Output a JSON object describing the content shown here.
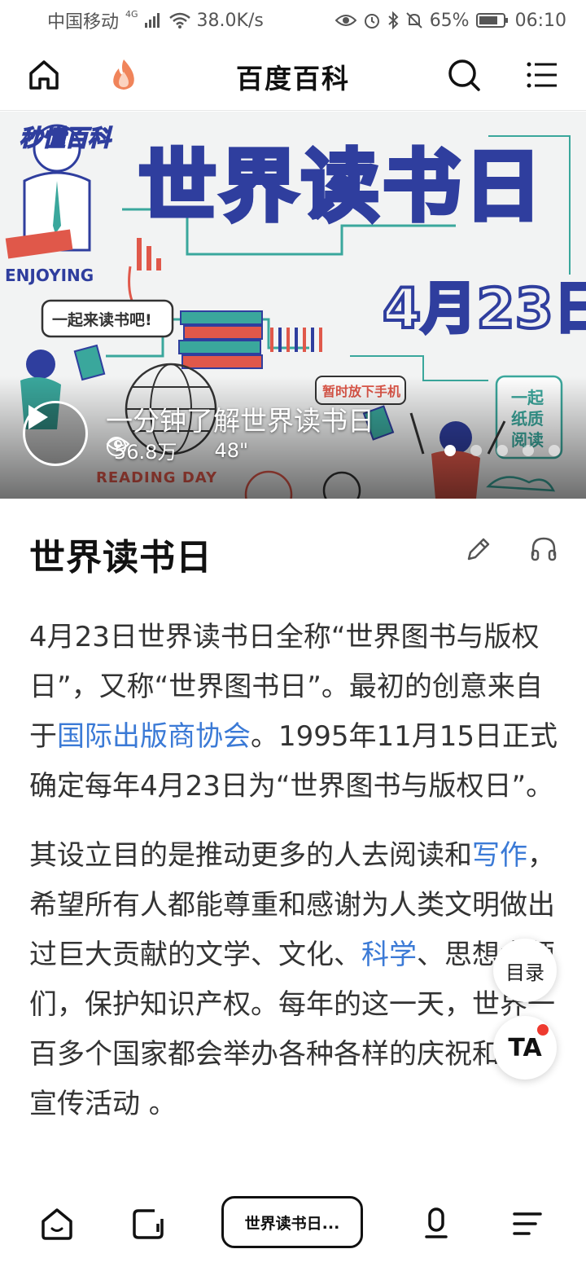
{
  "status_bar": {
    "carrier": "中国移动",
    "network": "4G",
    "speed": "38.0K/s",
    "battery": "65%",
    "time": "06:10"
  },
  "nav": {
    "title": "百度百科"
  },
  "hero": {
    "brand": "秒懂百科",
    "banner_title": "世界读书日",
    "banner_date": "4月23日",
    "enjoying": "ENJOYING",
    "bubble_left": "一起来读书吧!",
    "bubble_right": "暂时放下手机",
    "side_note": [
      "一起",
      "纸质",
      "阅读"
    ],
    "reading_day": "READING DAY",
    "caption": "一分钟了解世界读书日",
    "views": "56.8万",
    "duration": "48\"",
    "slide_count": 5,
    "active_slide": 1
  },
  "article": {
    "title": "世界读书日",
    "p1_a": "4月23日世界读书日全称“世界图书与版权日”，又称“世界图书日”。最初的创意来自于",
    "p1_link": "国际出版商协会",
    "p1_b": "。1995年11月15日正式确定每年4月23日为“世界图书与版权日”。",
    "p2_a": "其设立目的是推动更多的人去阅读和",
    "p2_link1": "写作",
    "p2_b": "，希望所有人都能尊重和感谢为人类文明做出过巨大贡献的文学、文化、",
    "p2_link2": "科学",
    "p2_c": "、思想大师们，保护知识产权。每年的这一天，世界一百多个国家都会举办各种各样的庆祝和图书宣传活动 。"
  },
  "floating": {
    "toc_label": "目录",
    "ta_label": "TA"
  },
  "bottom_bar": {
    "pill_label": "世界读书日..."
  },
  "colors": {
    "link": "#3b7ad6",
    "banner_blue": "#2f3e9e",
    "accent_red": "#e0584a",
    "teal": "#3aa79c"
  }
}
